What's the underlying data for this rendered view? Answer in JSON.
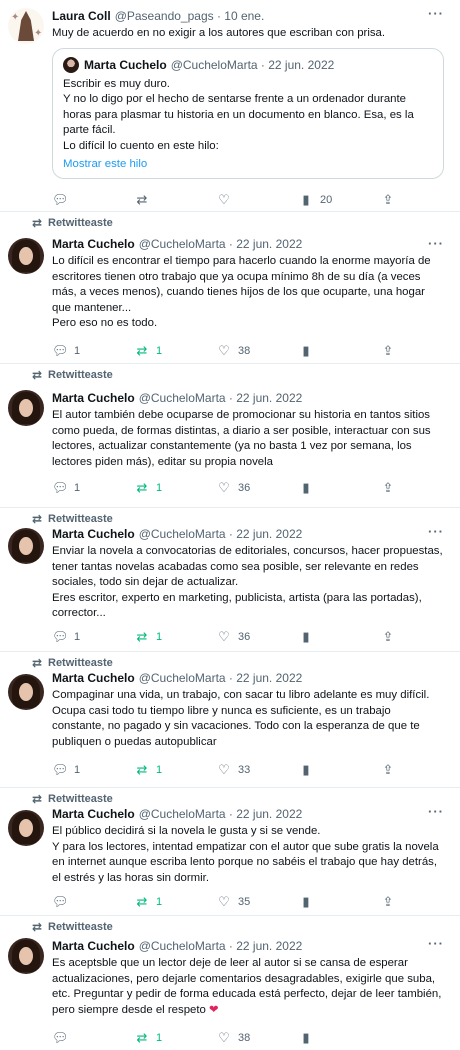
{
  "tweets": [
    {
      "retweeted_label": "",
      "author_name": "Laura Coll",
      "handle_date": "@Paseando_pags · 10 ene.",
      "text": "Muy de acuerdo en no exigir a los autores que escriban con prisa.",
      "quote": {
        "author_name": "Marta Cuchelo",
        "handle_date": "@CucheloMarta · 22 jun. 2022",
        "text": "Escribir es muy duro.\nY no lo digo por el hecho de sentarse frente a un ordenador durante horas para plasmar tu historia en un documento en blanco. Esa, es la parte fácil.\nLo difícil lo cuento en este hilo:",
        "show_thread": "Mostrar este hilo"
      },
      "replies": "",
      "retweets": "",
      "likes": "",
      "views": "20"
    },
    {
      "retweeted_label": "Retwitteaste",
      "author_name": "Marta Cuchelo",
      "handle_date": "@CucheloMarta · 22 jun. 2022",
      "text": "Lo difícil es encontrar el tiempo para hacerlo cuando la enorme mayoría de escritores tienen otro trabajo que ya ocupa mínimo 8h de su día (a veces más, a veces menos), cuando tienes hijos de los que ocuparte, una hogar que mantener...\nPero eso no es todo.",
      "replies": "1",
      "retweets": "1",
      "likes": "38",
      "views": ""
    },
    {
      "retweeted_label": "Retwitteaste",
      "author_name": "Marta Cuchelo",
      "handle_date": "@CucheloMarta · 22 jun. 2022",
      "text": "El autor también debe ocuparse de promocionar su historia en tantos sitios como pueda, de formas distintas, a diario a ser posible, interactuar con sus lectores, actualizar constantemente (ya no basta 1 vez por semana, los lectores piden más), editar su propia novela",
      "replies": "1",
      "retweets": "1",
      "likes": "36",
      "views": ""
    },
    {
      "retweeted_label": "Retwitteaste",
      "author_name": "Marta Cuchelo",
      "handle_date": "@CucheloMarta · 22 jun. 2022",
      "text": "Enviar la novela a convocatorias de editoriales, concursos, hacer propuestas, tener tantas novelas acabadas como sea posible, ser relevante en redes sociales, todo sin dejar de actualizar.\nEres escritor, experto en marketing, publicista, artista (para las portadas), corrector...",
      "replies": "1",
      "retweets": "1",
      "likes": "36",
      "views": ""
    },
    {
      "retweeted_label": "Retwitteaste",
      "author_name": "Marta Cuchelo",
      "handle_date": "@CucheloMarta · 22 jun. 2022",
      "text": "Compaginar una vida, un trabajo, con sacar tu libro adelante es muy difícil. Ocupa casi todo tu tiempo libre y nunca es suficiente, es un trabajo constante, no pagado y sin vacaciones. Todo con la esperanza de que te publiquen o puedas autopublicar",
      "replies": "1",
      "retweets": "1",
      "likes": "33",
      "views": ""
    },
    {
      "retweeted_label": "Retwitteaste",
      "author_name": "Marta Cuchelo",
      "handle_date": "@CucheloMarta · 22 jun. 2022",
      "text": "El público decidirá si la novela le gusta y si se vende.\nY para los lectores, intentad empatizar con el autor que sube gratis la novela en internet aunque escriba lento porque no sabéis el trabajo que hay detrás, el estrés y las horas sin dormir.",
      "replies": "",
      "retweets": "1",
      "likes": "35",
      "views": ""
    },
    {
      "retweeted_label": "Retwitteaste",
      "author_name": "Marta Cuchelo",
      "handle_date": "@CucheloMarta · 22 jun. 2022",
      "text": "Es aceptsble que un lector deje de leer al autor si se cansa de esperar actualizaciones, pero dejarle comentarios desagradables, exigirle que suba, etc. Preguntar y pedir de forma educada está perfecto, dejar de leer también, pero siempre desde el respeto ",
      "replies": "",
      "retweets": "1",
      "likes": "38",
      "views": ""
    }
  ],
  "icons": {
    "reply": "reply-icon",
    "retweet": "retweet-icon",
    "like": "heart-icon",
    "views": "views-icon",
    "share": "share-icon",
    "more": "more-icon",
    "red_heart": "red-heart-emoji"
  },
  "colors": {
    "retweet_green": "#00ba7c",
    "link_blue": "#1d9bf0",
    "muted": "#536471",
    "heart_red": "#e0245e"
  }
}
